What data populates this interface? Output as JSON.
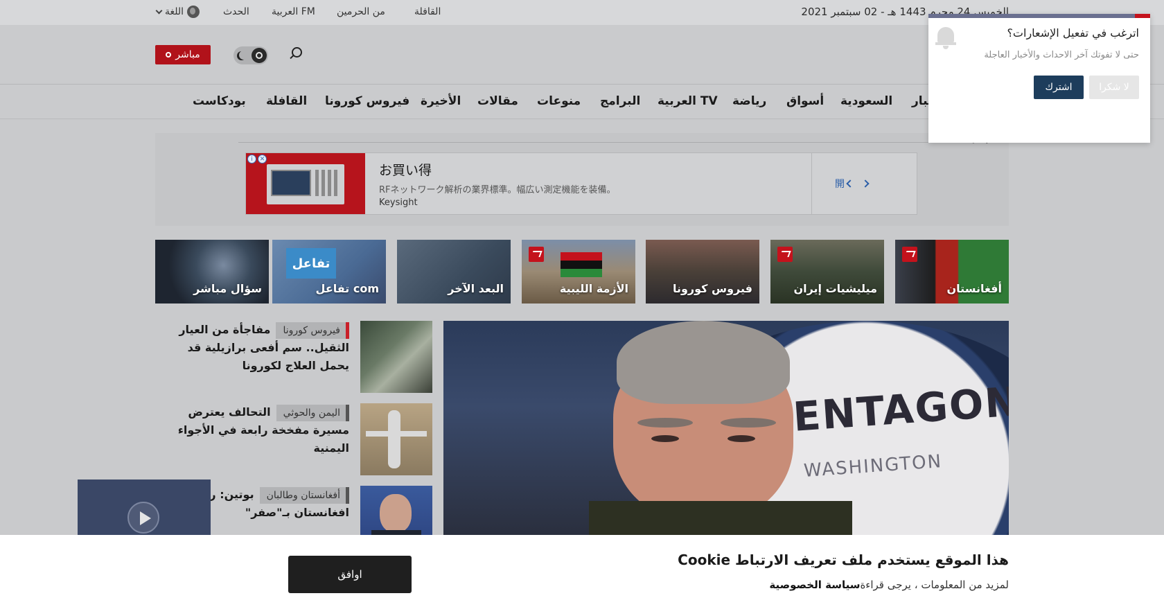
{
  "topbar": {
    "date": "الخميس 24 محرم 1443 هـ - 02 سبتمبر 2021",
    "links": [
      "القافلة",
      "من الحرمين",
      "العربية FM",
      "الحدث"
    ],
    "language": "اللغة"
  },
  "header": {
    "live_label": "مباشر"
  },
  "nav": {
    "items": [
      "أخبار",
      "السعودية",
      "أسواق",
      "رياضة",
      "العربية TV",
      "البرامج",
      "منوعات",
      "مقالات",
      "الأخيرة",
      "فيروس كورونا",
      "القافلة",
      "بودكاست"
    ]
  },
  "notification": {
    "title": "اترغب في تفعيل الإشعارات؟",
    "subtitle": "حتى لا تفوتك آخر الاحداث والأخبار العاجلة",
    "subscribe": "اشترك",
    "decline": "لا شكرا"
  },
  "ad": {
    "label": "مادة إعلانية",
    "title": "お買い得",
    "description": "RFネットワーク解析の業界標準。幅広い測定機能を装備。",
    "brand": "Keysight",
    "open": "開"
  },
  "topics": [
    {
      "label": "أفغانستان",
      "trending": true
    },
    {
      "label": "ميليشيات إيران",
      "trending": true
    },
    {
      "label": "فيروس كورونا",
      "trending": false
    },
    {
      "label": "الأزمة الليبية",
      "trending": true
    },
    {
      "label": "البعد الآخر",
      "trending": false
    },
    {
      "label": "تفاعل com",
      "trending": false
    },
    {
      "label": "سؤال مباشر",
      "trending": false
    }
  ],
  "hero": {
    "image_text_1": "PENTAGON",
    "image_text_2": "WASHINGTON"
  },
  "news": [
    {
      "tag": "فيروس كورونا",
      "headline": "مفاجأة من العيار الثقيل.. سم أفعى برازيلية قد يحمل العلاج لكورونا"
    },
    {
      "tag": "اليمن والحوثي",
      "headline": "التحالف يعترض مسيرة مفخخة رابعة في الأجواء اليمنية"
    },
    {
      "tag": "أفغانستان وطالبان",
      "headline": "بوتين: رحلت عن افغانستان بـ\"صفر\""
    }
  ],
  "cookie": {
    "title": "هذا الموقع يستخدم ملف تعريف الارتباط Cookie",
    "text": "لمزيد من المعلومات ، يرجى قراءة",
    "policy": "سياسة الخصوصية",
    "agree": "اوافق"
  }
}
